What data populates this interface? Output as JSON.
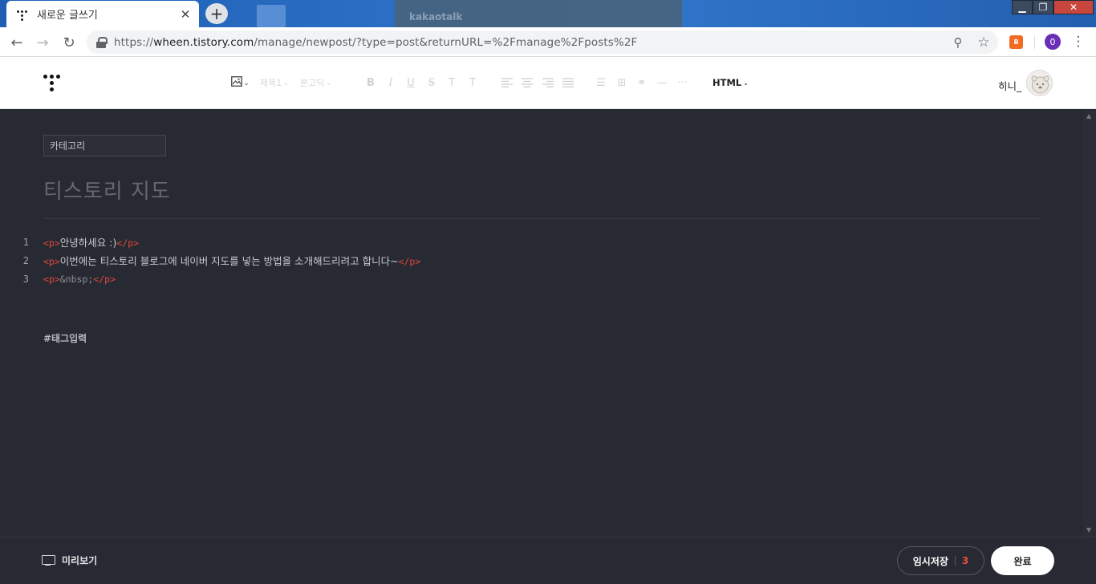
{
  "browser": {
    "tab": {
      "title": "새로운 글쓰기",
      "close": "✕"
    },
    "new_tab": "+",
    "background_window_title": "kakaotalk",
    "window_controls": {
      "minimize": "▁",
      "maximize": "❐",
      "close": "✕"
    },
    "nav": {
      "back": "←",
      "forward": "→",
      "reload": "↻"
    },
    "url": {
      "scheme": "https://",
      "host": "wheen.tistory.com",
      "path": "/manage/newpost/?type=post&returnURL=%2Fmanage%2Fposts%2F"
    },
    "omnibox_icons": {
      "zoom": "⚲",
      "bookmark": "☆"
    },
    "extension_label": "B",
    "profile_initial": "0",
    "menu": "⋮"
  },
  "toolbar": {
    "image_icon": "🖼",
    "heading_label": "제목1",
    "font_label": "본고딕",
    "bold": "B",
    "italic": "I",
    "underline": "U",
    "strike": "S",
    "text_color": "T",
    "text_bg": "T",
    "list": "☰",
    "table": "⊞",
    "link": "⚭",
    "divider": "—",
    "more": "···",
    "mode_label": "HTML",
    "caret": "⌄"
  },
  "user": {
    "name": "히니_"
  },
  "editor": {
    "category_placeholder": "카테고리",
    "title": "티스토리 지도",
    "lines": [
      {
        "num": "1",
        "open": "<p>",
        "text": "안녕하세요 :)",
        "close": "</p>"
      },
      {
        "num": "2",
        "open": "<p>",
        "text": "이번에는 티스토리 블로그에 네이버 지도를 넣는 방법을 소개해드리려고 합니다~",
        "close": "</p>"
      },
      {
        "num": "3",
        "open": "<p>",
        "text": "&nbsp;",
        "close": "</p>"
      }
    ],
    "tag_placeholder": "#태그입력"
  },
  "footer": {
    "preview_label": "미리보기",
    "draft_label": "임시저장",
    "draft_count": "3",
    "done_label": "완료"
  },
  "colors": {
    "editor_bg": "#272a32",
    "tag_red": "#e2463c",
    "draft_count": "#ef4b3f"
  }
}
